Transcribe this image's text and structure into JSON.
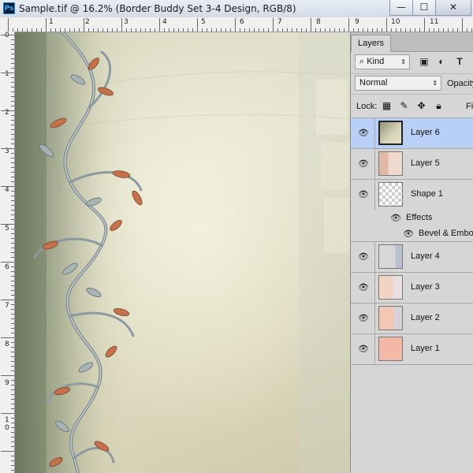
{
  "window": {
    "app_icon": "Ps",
    "title": "Sample.tif @ 16.2% (Border Buddy Set 3-4  Design, RGB/8)",
    "min_label": "—",
    "max_label": "☐",
    "close_label": "✕"
  },
  "ruler": {
    "top": [
      "1",
      "2",
      "3",
      "4",
      "5",
      "6",
      "7",
      "8",
      "9",
      "10",
      "11"
    ],
    "left": [
      "0",
      "1",
      "2",
      "3",
      "4",
      "5",
      "6",
      "7",
      "8",
      "9",
      "1",
      "0"
    ]
  },
  "panel": {
    "tab_label": "Layers",
    "kind_label": "Kind",
    "blend_mode": "Normal",
    "opacity_label": "Opacity",
    "lock_label": "Lock:",
    "fill_label": "Fill",
    "icons": [
      "search-icon",
      "image-filter-icon",
      "adjustment-filter-icon",
      "type-filter-icon",
      "lock-transparent-icon",
      "lock-paint-icon",
      "lock-move-icon",
      "lock-all-icon"
    ]
  },
  "layers": [
    {
      "name": "Layer 6",
      "selected": true
    },
    {
      "name": "Layer 5",
      "selected": false
    },
    {
      "name": "Shape 1",
      "selected": false,
      "effects_label": "Effects",
      "effect": "Bevel & Emboss"
    },
    {
      "name": "Layer 4",
      "selected": false
    },
    {
      "name": "Layer 3",
      "selected": false
    },
    {
      "name": "Layer 2",
      "selected": false
    },
    {
      "name": "Layer 1",
      "selected": false
    }
  ],
  "colors": {
    "selection": "#b8d0f5",
    "layer1_fill": "#f2b9a6",
    "canvas_base": "#dcdcc4",
    "ornament_copper": "#c8704a",
    "ornament_silver": "#8c9aa0"
  }
}
